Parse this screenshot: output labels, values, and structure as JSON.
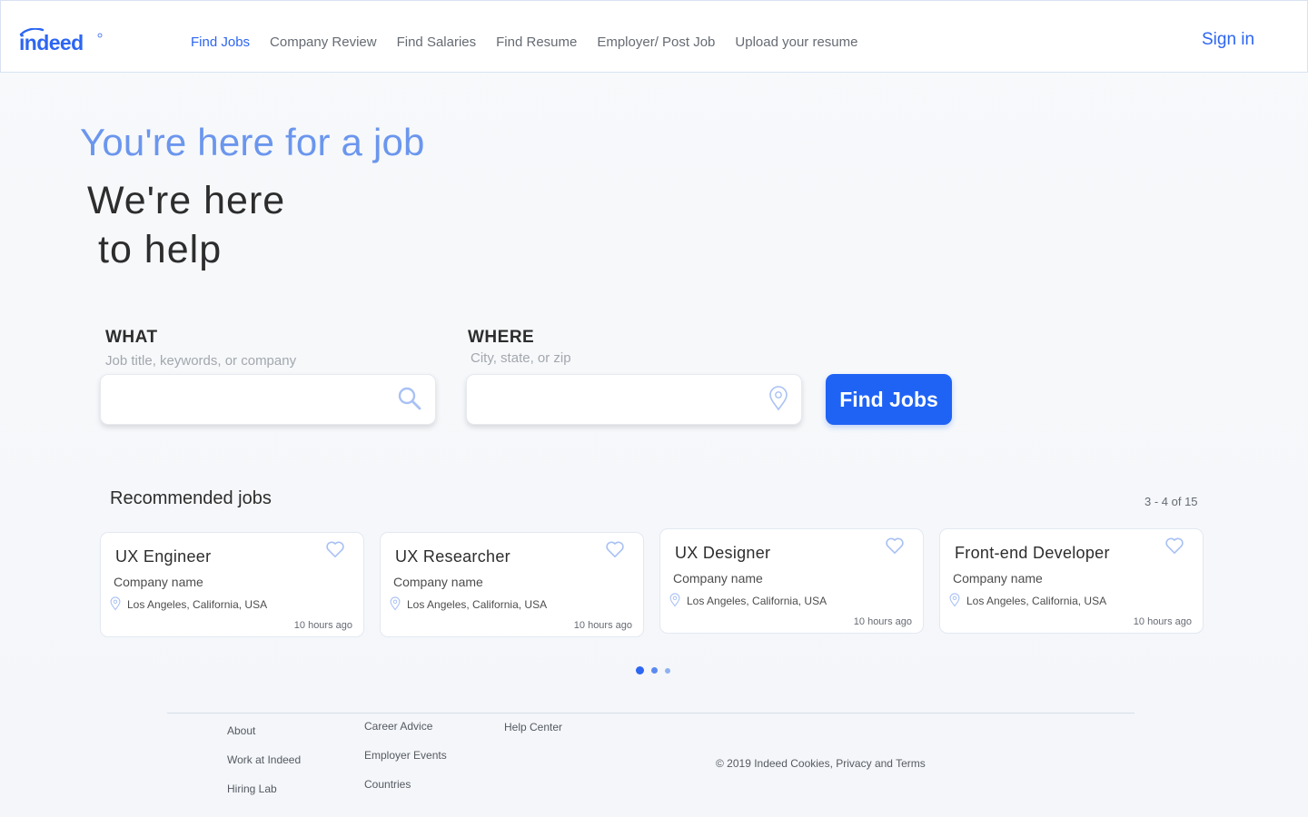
{
  "header": {
    "logo": "indeed",
    "nav": [
      {
        "label": "Find Jobs",
        "active": true
      },
      {
        "label": "Company Review"
      },
      {
        "label": "Find Salaries"
      },
      {
        "label": "Find Resume"
      },
      {
        "label": "Employer/ Post Job"
      },
      {
        "label": "Upload your resume"
      }
    ],
    "sign_in": "Sign in"
  },
  "hero": {
    "line1": "You're here for a job",
    "line2a": "We're here",
    "line2b": "to help"
  },
  "search": {
    "what_label": "WHAT",
    "what_hint": "Job title, keywords, or company",
    "what_value": "",
    "where_label": "WHERE",
    "where_hint": "City, state, or zip",
    "where_value": "",
    "button": "Find Jobs"
  },
  "recommended": {
    "title": "Recommended jobs",
    "count": "3 - 4 of 15",
    "jobs": [
      {
        "title": "UX Engineer",
        "company": "Company name",
        "location": "Los Angeles, California, USA",
        "posted": "10 hours ago"
      },
      {
        "title": "UX Researcher",
        "company": "Company name",
        "location": "Los Angeles, California, USA",
        "posted": "10 hours ago"
      },
      {
        "title": "UX Designer",
        "company": "Company name",
        "location": "Los Angeles, California, USA",
        "posted": "10 hours ago"
      },
      {
        "title": "Front-end Developer",
        "company": "Company name",
        "location": "Los Angeles, California, USA",
        "posted": "10 hours ago"
      }
    ],
    "pagination_pages": 3,
    "current_page": 1
  },
  "footer": {
    "col1": [
      "About",
      "Work at Indeed",
      "Hiring Lab"
    ],
    "col2": [
      "Career Advice",
      "Employer Events",
      "Countries"
    ],
    "col3": [
      "Help Center"
    ],
    "copyright": "© 2019 Indeed Cookies,  Privacy and Terms"
  },
  "colors": {
    "accent": "#1f63f5",
    "link": "#2d66f2",
    "hero_light": "#6b96ee",
    "icon_light": "#a9c1f4",
    "dot_active": "#2d66f2",
    "dot_mid": "#5a8af0",
    "dot_light": "#8fb1f3"
  },
  "icons": {
    "search": "search-icon",
    "location": "location-pin-icon",
    "heart": "heart-icon"
  }
}
